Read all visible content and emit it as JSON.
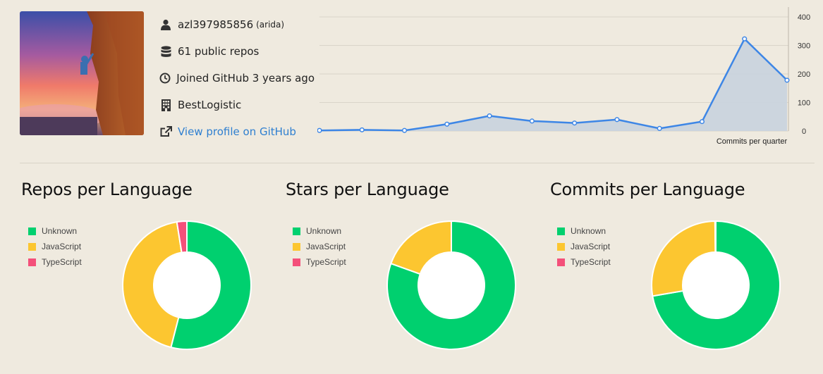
{
  "profile": {
    "username": "azl397985856",
    "name": "(arida)",
    "repos_text": "61 public repos",
    "joined_text": "Joined GitHub 3 years ago",
    "company": "BestLogistic",
    "link_text": "View profile on GitHub"
  },
  "icons": {
    "user": "user-icon",
    "repos": "database-icon",
    "joined": "clock-icon",
    "company": "building-icon",
    "link": "external-link-icon"
  },
  "activity_chart": {
    "type": "area",
    "xlabel": "Commits per quarter",
    "ylim": [
      0,
      400
    ],
    "yticks": [
      "400",
      "300",
      "200",
      "100",
      "0"
    ],
    "values": [
      2,
      4,
      2,
      24,
      53,
      35,
      28,
      40,
      9,
      33,
      323,
      178
    ],
    "line_color": "#3d86e6",
    "fill_color": "#c8d3de"
  },
  "colors": {
    "Unknown": "#00d06f",
    "JavaScript": "#fcc630",
    "TypeScript": "#f4507a"
  },
  "chart_data": [
    {
      "type": "pie",
      "title": "Repos per Language",
      "labels": [
        "Unknown",
        "JavaScript",
        "TypeScript"
      ],
      "values": [
        54,
        43.5,
        2.5
      ]
    },
    {
      "type": "pie",
      "title": "Stars per Language",
      "labels": [
        "Unknown",
        "JavaScript",
        "TypeScript"
      ],
      "values": [
        80.5,
        19.5,
        0
      ]
    },
    {
      "type": "pie",
      "title": "Commits per Language",
      "labels": [
        "Unknown",
        "JavaScript",
        "TypeScript"
      ],
      "values": [
        72.3,
        27.5,
        0.2
      ]
    }
  ]
}
